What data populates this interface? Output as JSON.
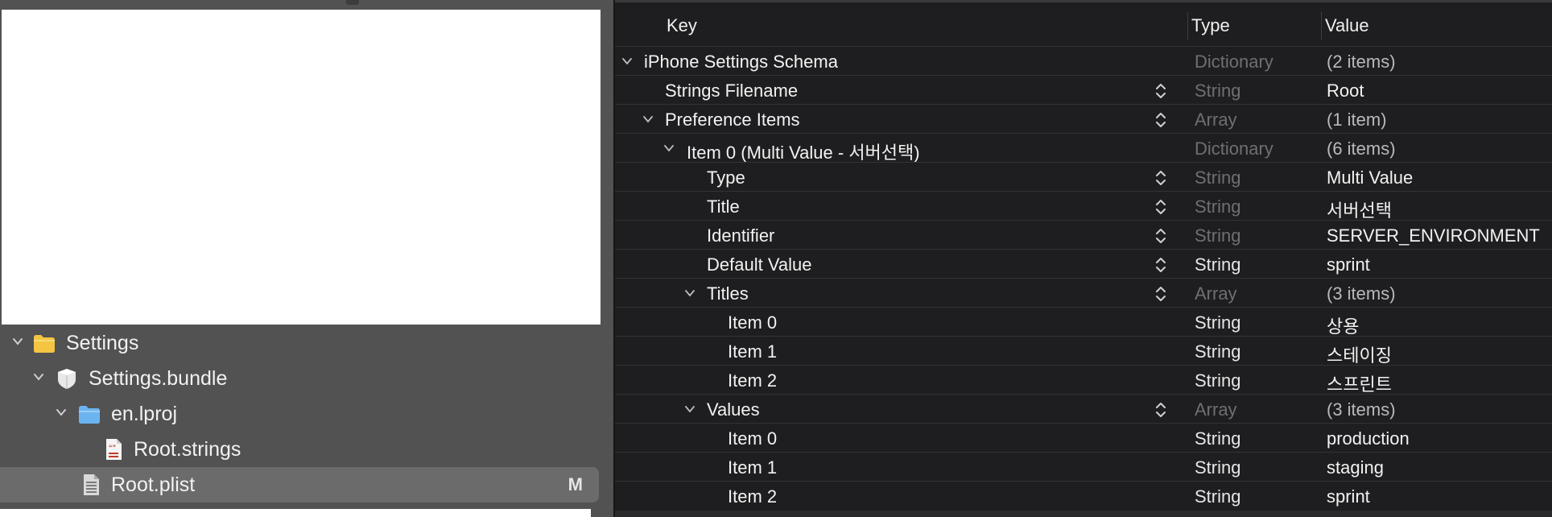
{
  "navigator": {
    "items": [
      {
        "label": "Settings",
        "icon": "folder-icon"
      },
      {
        "label": "Settings.bundle",
        "icon": "bundle-icon"
      },
      {
        "label": "en.lproj",
        "icon": "folder-icon"
      },
      {
        "label": "Root.strings",
        "icon": "strings-file-icon"
      },
      {
        "label": "Root.plist",
        "icon": "plist-file-icon",
        "badge": "M",
        "selected": true
      }
    ]
  },
  "plist": {
    "headers": {
      "key": "Key",
      "type": "Type",
      "value": "Value"
    },
    "rows": [
      {
        "key": "iPhone Settings Schema",
        "type": "Dictionary",
        "value": "(2 items)"
      },
      {
        "key": "Strings Filename",
        "type": "String",
        "value": "Root"
      },
      {
        "key": "Preference Items",
        "type": "Array",
        "value": "(1 item)"
      },
      {
        "key": "Item 0 (Multi Value - 서버선택)",
        "type": "Dictionary",
        "value": "(6 items)"
      },
      {
        "key": "Type",
        "type": "String",
        "value": "Multi Value"
      },
      {
        "key": "Title",
        "type": "String",
        "value": "서버선택"
      },
      {
        "key": "Identifier",
        "type": "String",
        "value": "SERVER_ENVIRONMENT"
      },
      {
        "key": "Default Value",
        "type": "String",
        "value": "sprint"
      },
      {
        "key": "Titles",
        "type": "Array",
        "value": "(3 items)"
      },
      {
        "key": "Item 0",
        "type": "String",
        "value": "상용"
      },
      {
        "key": "Item 1",
        "type": "String",
        "value": "스테이징"
      },
      {
        "key": "Item 2",
        "type": "String",
        "value": "스프린트"
      },
      {
        "key": "Values",
        "type": "Array",
        "value": "(3 items)"
      },
      {
        "key": "Item 0",
        "type": "String",
        "value": "production"
      },
      {
        "key": "Item 1",
        "type": "String",
        "value": "staging"
      },
      {
        "key": "Item 2",
        "type": "String",
        "value": "sprint"
      }
    ]
  },
  "colors": {
    "navigator_bg": "#525253",
    "editor_bg": "#1e1e20",
    "folder_yellow": "#f4c542",
    "folder_blue": "#6cb4f0"
  }
}
